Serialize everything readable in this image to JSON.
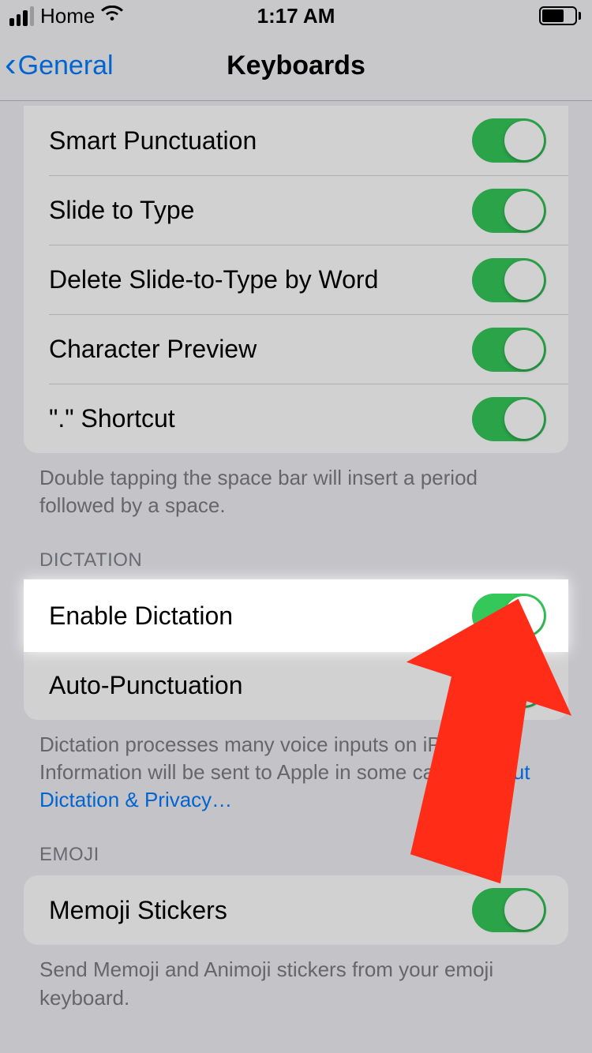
{
  "status": {
    "carrier": "Home",
    "time": "1:17 AM"
  },
  "nav": {
    "back": "General",
    "title": "Keyboards"
  },
  "section1": {
    "rows": [
      {
        "label": "Smart Punctuation",
        "on": true
      },
      {
        "label": "Slide to Type",
        "on": true
      },
      {
        "label": "Delete Slide-to-Type by Word",
        "on": true
      },
      {
        "label": "Character Preview",
        "on": true
      },
      {
        "label": "\".\" Shortcut",
        "on": true
      }
    ],
    "footer": "Double tapping the space bar will insert a period followed by a space."
  },
  "dictation": {
    "header": "DICTATION",
    "rows": [
      {
        "label": "Enable Dictation",
        "on": true
      },
      {
        "label": "Auto-Punctuation",
        "on": true
      }
    ],
    "footer": "Dictation processes many voice inputs on iPhone. Information will be sent to Apple in some cases. ",
    "link": "About Dictation & Privacy…"
  },
  "emoji": {
    "header": "EMOJI",
    "rows": [
      {
        "label": "Memoji Stickers",
        "on": true
      }
    ],
    "footer": "Send Memoji and Animoji stickers from your emoji keyboard."
  }
}
